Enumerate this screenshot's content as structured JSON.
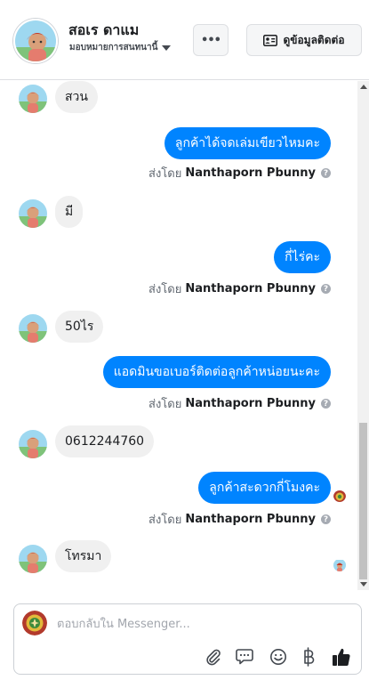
{
  "header": {
    "contact_name": "สอเร ดาแม",
    "assign_label": "มอบหมายการสนทนานี้",
    "more_label": "•••",
    "contact_info_label": "ดูข้อมูลติดต่อ"
  },
  "messages": [
    {
      "direction": "in",
      "text": "สวน"
    },
    {
      "direction": "out",
      "text": "ลูกค้าได้จดเล่มเขียวไหมคะ",
      "sent_by_prefix": "ส่งโดย",
      "sent_by_name": "Nanthaporn Pbunny"
    },
    {
      "direction": "in",
      "text": "มี"
    },
    {
      "direction": "out",
      "text": "กี่ไร่คะ",
      "sent_by_prefix": "ส่งโดย",
      "sent_by_name": "Nanthaporn Pbunny"
    },
    {
      "direction": "in",
      "text": "50ไร"
    },
    {
      "direction": "out",
      "text": "แอดมินขอเบอร์ติดต่อลูกค้าหน่อยนะคะ",
      "sent_by_prefix": "ส่งโดย",
      "sent_by_name": "Nanthaporn Pbunny"
    },
    {
      "direction": "in",
      "text": "0612244760"
    },
    {
      "direction": "out",
      "text": "ลูกค้าสะดวกกี่โมงคะ",
      "sent_by_prefix": "ส่งโดย",
      "sent_by_name": "Nanthaporn Pbunny"
    },
    {
      "direction": "in",
      "text": "โทรมา"
    }
  ],
  "composer": {
    "placeholder": "ตอบกลับใน Messenger..."
  },
  "icons": {
    "attach": "paperclip-icon",
    "saved_replies": "chat-bubbles-icon",
    "emoji": "smiley-icon",
    "payment": "baht-icon",
    "like": "thumbs-up-icon",
    "help": "?"
  },
  "colors": {
    "outgoing_bubble": "#0084ff",
    "incoming_bubble": "#f0f0f0",
    "page_bg": "#ffffff"
  }
}
